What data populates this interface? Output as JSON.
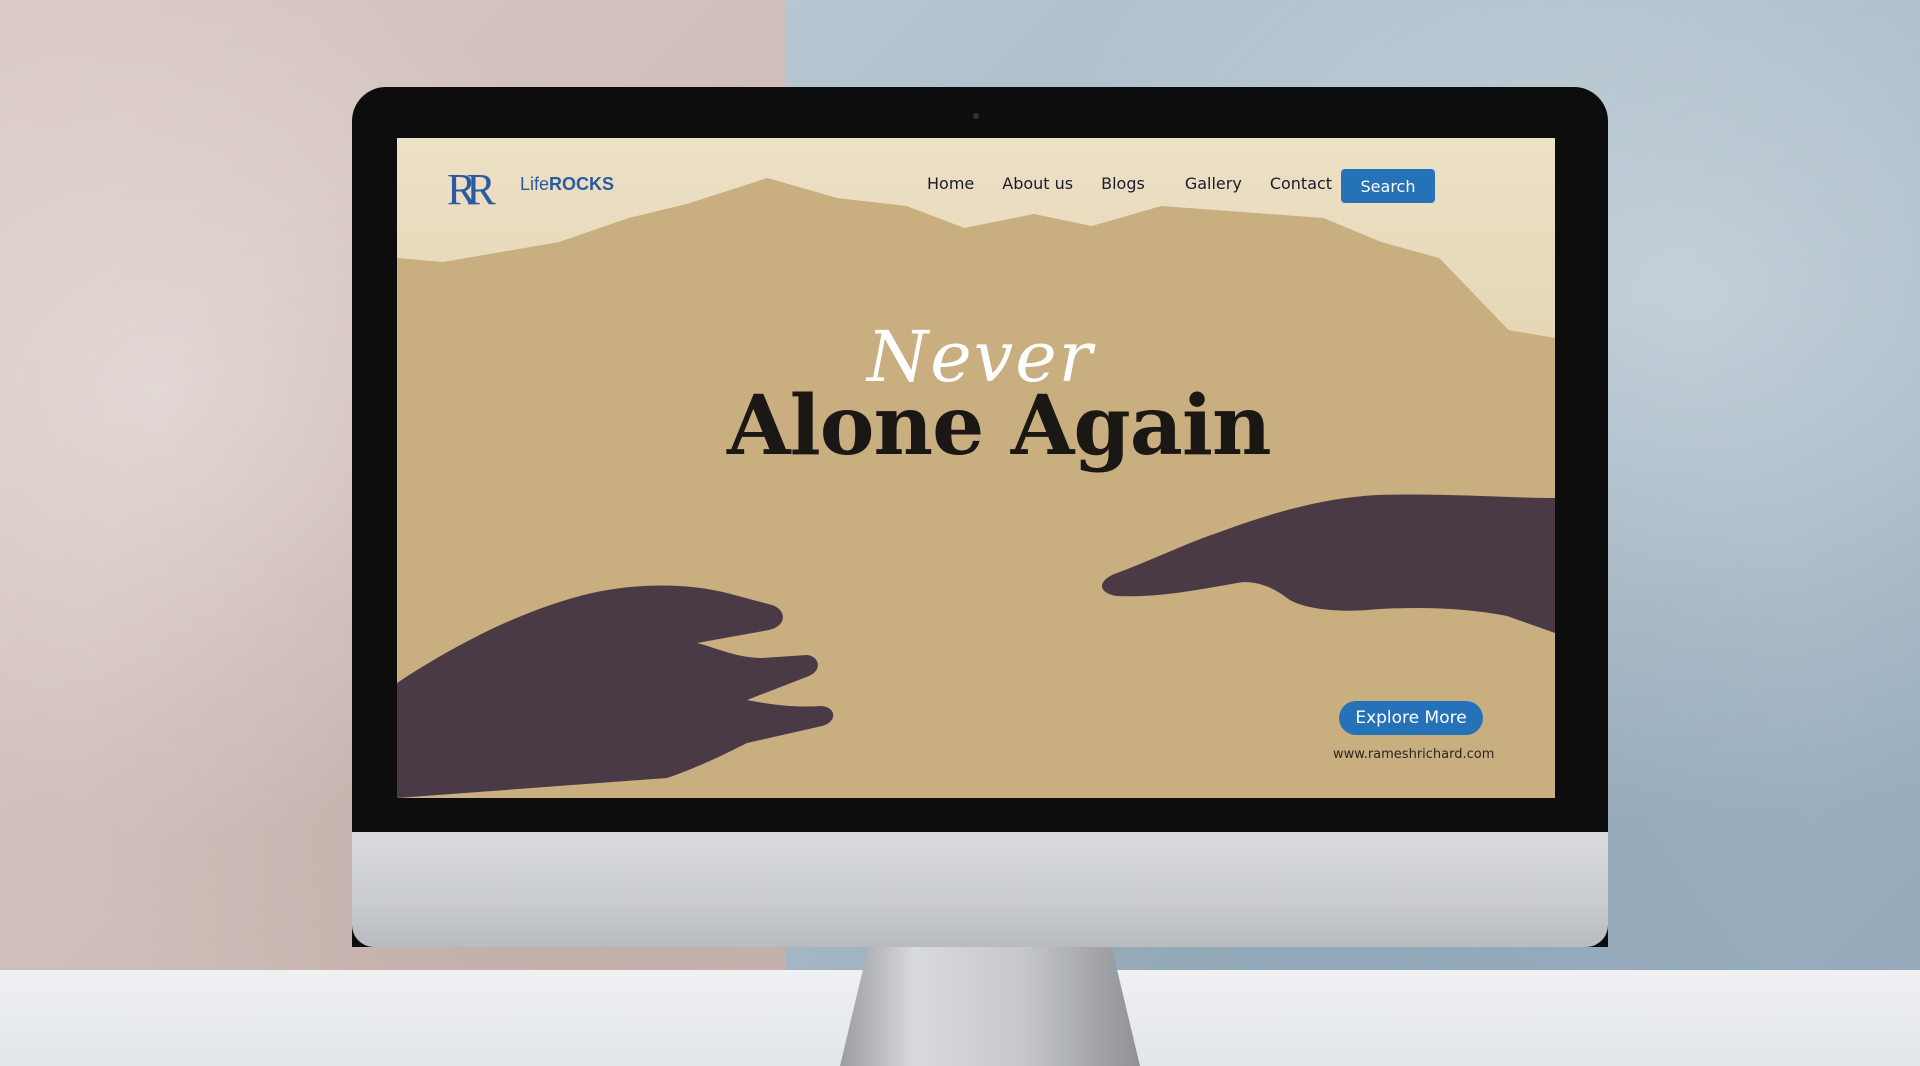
{
  "logo": {
    "rr": "RR",
    "life": "Life",
    "rocks": "ROCKS"
  },
  "nav": {
    "items": [
      "Home",
      "About us",
      "Blogs",
      "Gallery",
      "Contact"
    ],
    "search_label": "Search"
  },
  "hero": {
    "script": "Never",
    "headline": "Alone Again"
  },
  "cta": {
    "explore_label": "Explore More",
    "site_url": "www.rameshrichard.com"
  },
  "colors": {
    "accent": "#2572b8",
    "background": "#c9ae80",
    "text": "#1b1714"
  }
}
